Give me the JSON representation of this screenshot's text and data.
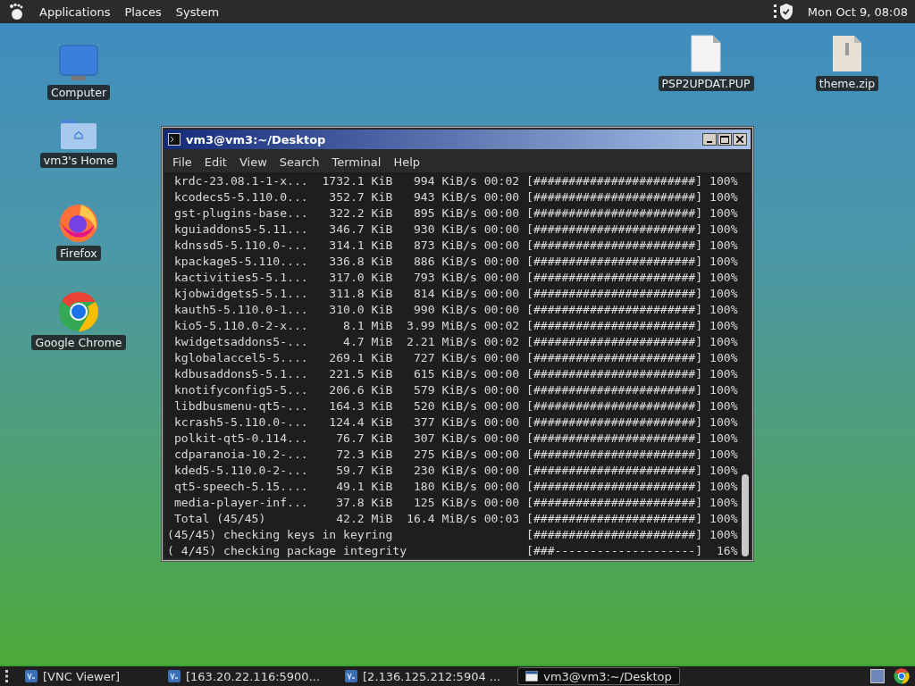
{
  "top_panel": {
    "menus": [
      "Applications",
      "Places",
      "System"
    ],
    "clock": "Mon Oct 9, 08:08"
  },
  "desktop_icons": [
    {
      "label": "Computer",
      "kind": "computer"
    },
    {
      "label": "vm3's Home",
      "kind": "home"
    },
    {
      "label": "Firefox",
      "kind": "firefox"
    },
    {
      "label": "Google Chrome",
      "kind": "chrome"
    },
    {
      "label": "PSP2UPDAT.PUP",
      "kind": "file"
    },
    {
      "label": "theme.zip",
      "kind": "zip"
    }
  ],
  "terminal": {
    "title": "vm3@vm3:~/Desktop",
    "menu": [
      "File",
      "Edit",
      "View",
      "Search",
      "Terminal",
      "Help"
    ],
    "lines": [
      " krdc-23.08.1-1-x...  1732.1 KiB   994 KiB/s 00:02 [#######################] 100%",
      " kcodecs5-5.110.0...   352.7 KiB   943 KiB/s 00:00 [#######################] 100%",
      " gst-plugins-base...   322.2 KiB   895 KiB/s 00:00 [#######################] 100%",
      " kguiaddons5-5.11...   346.7 KiB   930 KiB/s 00:00 [#######################] 100%",
      " kdnssd5-5.110.0-...   314.1 KiB   873 KiB/s 00:00 [#######################] 100%",
      " kpackage5-5.110....   336.8 KiB   886 KiB/s 00:00 [#######################] 100%",
      " kactivities5-5.1...   317.0 KiB   793 KiB/s 00:00 [#######################] 100%",
      " kjobwidgets5-5.1...   311.8 KiB   814 KiB/s 00:00 [#######################] 100%",
      " kauth5-5.110.0-1...   310.0 KiB   990 KiB/s 00:00 [#######################] 100%",
      " kio5-5.110.0-2-x...     8.1 MiB  3.99 MiB/s 00:02 [#######################] 100%",
      " kwidgetsaddons5-...     4.7 MiB  2.21 MiB/s 00:02 [#######################] 100%",
      " kglobalaccel5-5....   269.1 KiB   727 KiB/s 00:00 [#######################] 100%",
      " kdbusaddons5-5.1...   221.5 KiB   615 KiB/s 00:00 [#######################] 100%",
      " knotifyconfig5-5...   206.6 KiB   579 KiB/s 00:00 [#######################] 100%",
      " libdbusmenu-qt5-...   164.3 KiB   520 KiB/s 00:00 [#######################] 100%",
      " kcrash5-5.110.0-...   124.4 KiB   377 KiB/s 00:00 [#######################] 100%",
      " polkit-qt5-0.114...    76.7 KiB   307 KiB/s 00:00 [#######################] 100%",
      " cdparanoia-10.2-...    72.3 KiB   275 KiB/s 00:00 [#######################] 100%",
      " kded5-5.110.0-2-...    59.7 KiB   230 KiB/s 00:00 [#######################] 100%",
      " qt5-speech-5.15....    49.1 KiB   180 KiB/s 00:00 [#######################] 100%",
      " media-player-inf...    37.8 KiB   125 KiB/s 00:00 [#######################] 100%",
      " Total (45/45)          42.2 MiB  16.4 MiB/s 00:03 [#######################] 100%",
      "(45/45) checking keys in keyring                   [#######################] 100%",
      "( 4/45) checking package integrity                 [###--------------------]  16%"
    ]
  },
  "taskbar": {
    "items": [
      {
        "label": "[VNC Viewer]",
        "kind": "vnc",
        "selected": false
      },
      {
        "label": "[163.20.22.116:5900...",
        "kind": "vnc",
        "selected": false
      },
      {
        "label": "[2.136.125.212:5904 ...",
        "kind": "vnc",
        "selected": false
      },
      {
        "label": "vm3@vm3:~/Desktop",
        "kind": "terminal",
        "selected": true
      }
    ]
  }
}
